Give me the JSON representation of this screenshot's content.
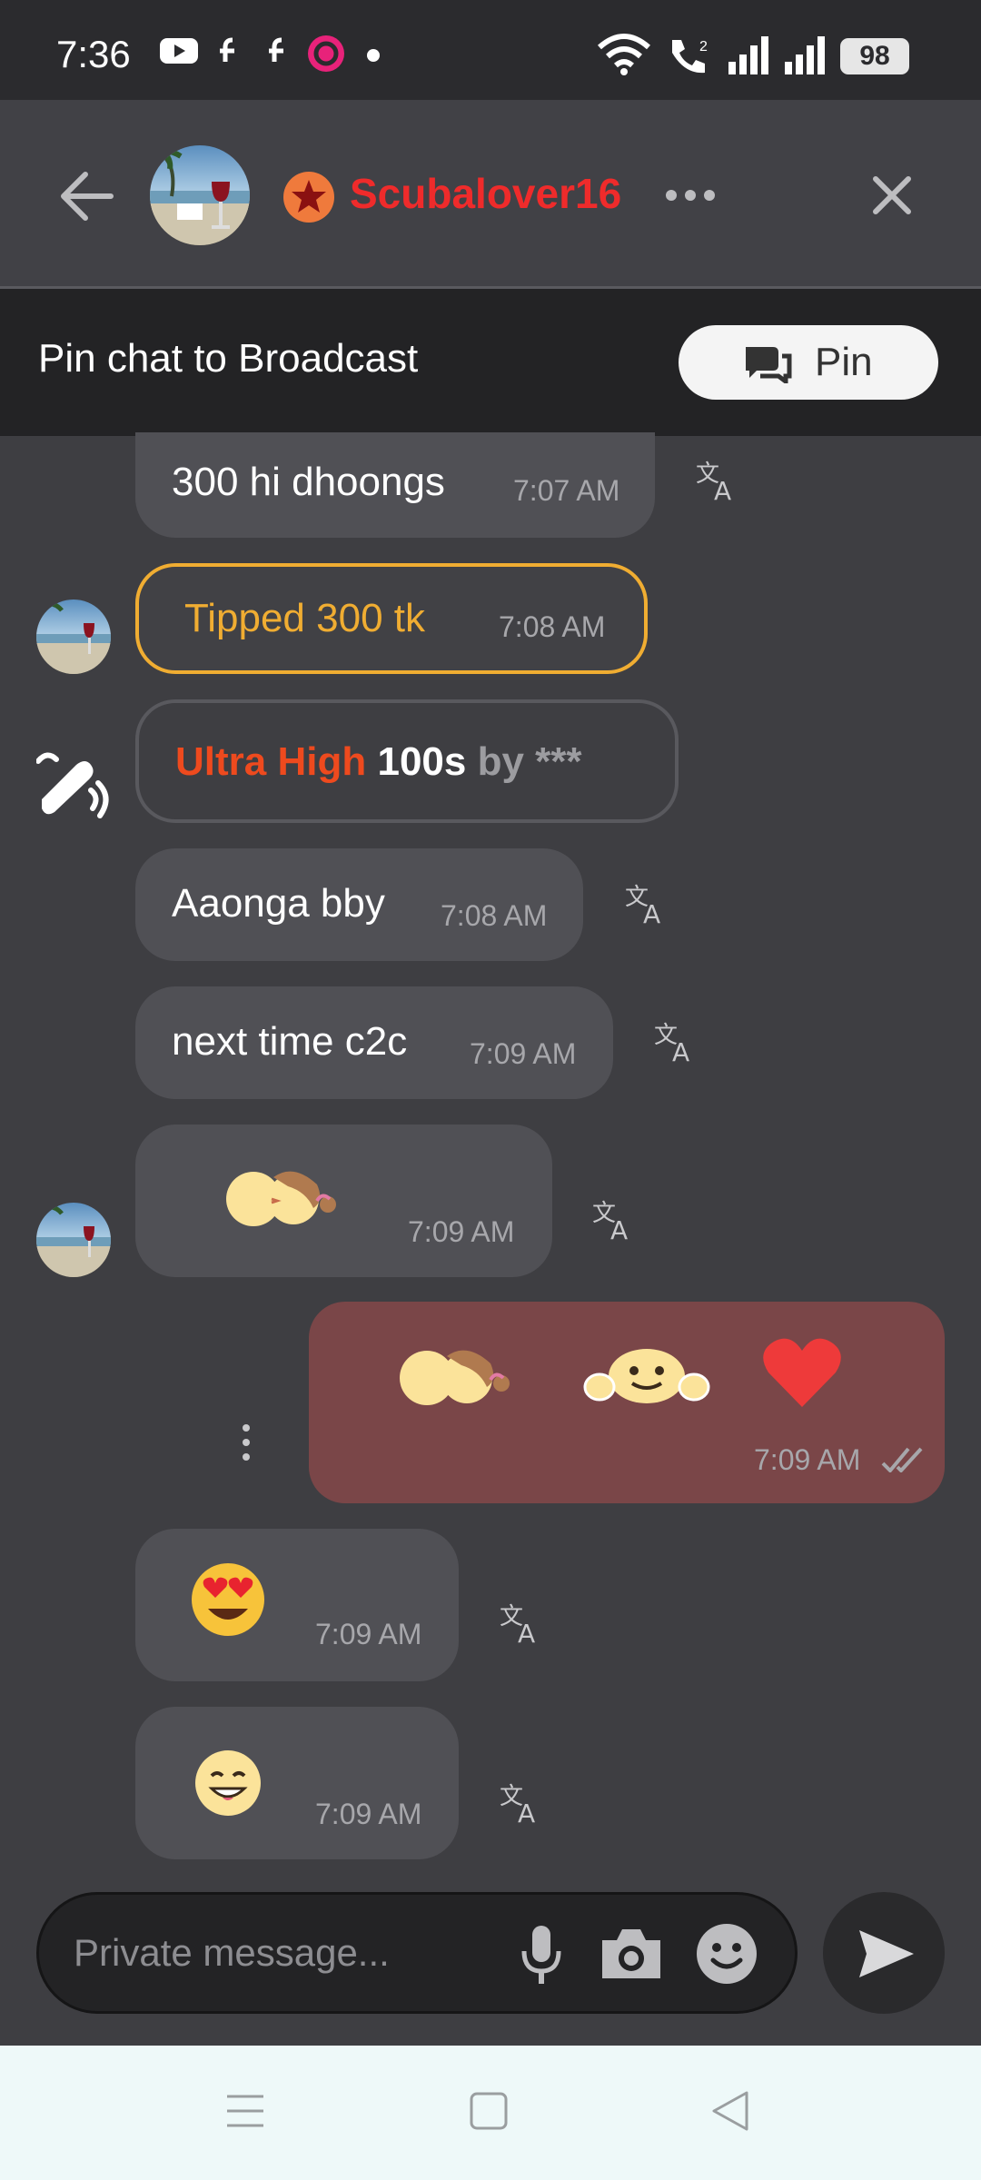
{
  "status_bar": {
    "time": "7:36",
    "battery": "98"
  },
  "header": {
    "contact_name": "Scubalover16"
  },
  "pin_bar": {
    "text": "Pin chat to Broadcast",
    "button_label": "Pin"
  },
  "messages": [
    {
      "text": "300 hi dhoongs",
      "time": "7:07 AM"
    },
    {
      "text": "Tipped 300 tk",
      "time": "7:08 AM"
    },
    {
      "ultra_label": "Ultra High",
      "ultra_duration": "100s",
      "ultra_by": "by ***"
    },
    {
      "text": "Aaonga bby",
      "time": "7:08 AM"
    },
    {
      "text": "next time c2c",
      "time": "7:09 AM"
    },
    {
      "emoji": "kissing-couple",
      "time": "7:09 AM"
    },
    {
      "emoji": [
        "kissing-couple",
        "hugging-face",
        "red-heart"
      ],
      "time": "7:09 AM",
      "sent": true,
      "status": "read"
    },
    {
      "emoji": "heart-eyes-face",
      "time": "7:09 AM"
    },
    {
      "emoji": "grinning-face",
      "time": "7:09 AM"
    }
  ],
  "input": {
    "placeholder": "Private message..."
  },
  "colors": {
    "accent_name": "#ef2b2b",
    "tip_border": "#f0ad32",
    "ultra_label": "#ee4a1e",
    "sent_bubble": "#7a4648"
  }
}
